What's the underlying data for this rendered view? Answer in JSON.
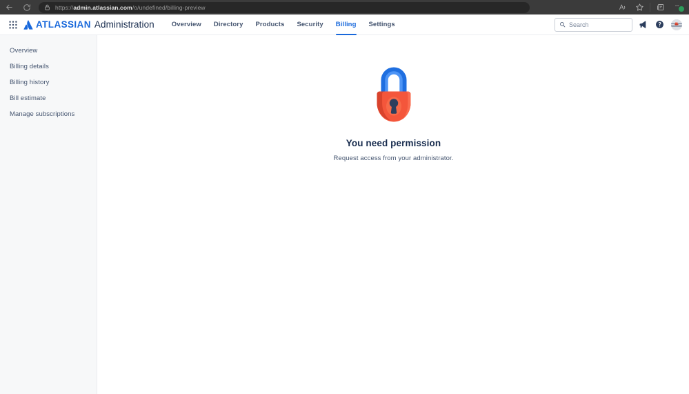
{
  "browser": {
    "back_label": "Back",
    "reload_label": "Reload",
    "url_prefix": "https://",
    "url_domain": "admin.atlassian.com",
    "url_path": "/o/undefined/billing-preview",
    "read_aloud_label": "Read aloud",
    "favorite_label": "Add to favorites",
    "collections_label": "Collections",
    "profile_label": "Profile",
    "profile_badge": ""
  },
  "header": {
    "app_switcher_label": "App switcher",
    "brand": "ATLASSIAN",
    "product": "Administration",
    "nav": [
      {
        "label": "Overview",
        "active": false
      },
      {
        "label": "Directory",
        "active": false
      },
      {
        "label": "Products",
        "active": false
      },
      {
        "label": "Security",
        "active": false
      },
      {
        "label": "Billing",
        "active": true
      },
      {
        "label": "Settings",
        "active": false
      }
    ],
    "search_placeholder": "Search",
    "search_value": "",
    "notifications_label": "Announcements",
    "help_label": "Help",
    "avatar_label": "Your profile and settings",
    "accent_color": "#1868db",
    "text_color": "#44546f"
  },
  "sidebar": {
    "items": [
      {
        "label": "Overview"
      },
      {
        "label": "Billing details"
      },
      {
        "label": "Billing history"
      },
      {
        "label": "Bill estimate"
      },
      {
        "label": "Manage subscriptions"
      }
    ]
  },
  "main": {
    "illustration_label": "padlock-illustration",
    "title": "You need permission",
    "subtitle": "Request access from your administrator.",
    "lock_body_color": "#f4563b",
    "lock_shackle_color": "#3b7fe8",
    "lock_keyhole_color": "#2c3e5d"
  }
}
